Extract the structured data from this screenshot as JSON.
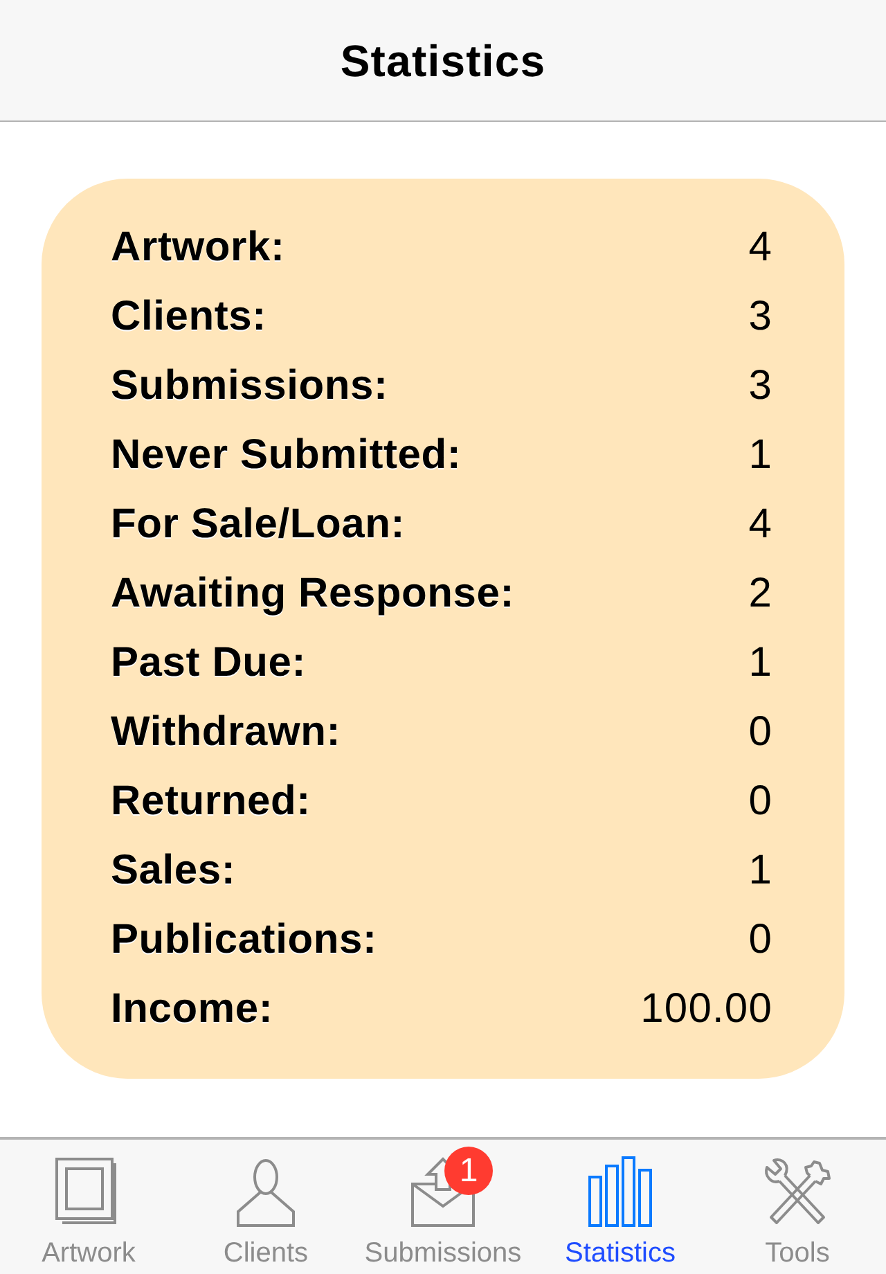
{
  "nav_bar": {
    "title": "Statistics"
  },
  "stats": [
    {
      "label": "Artwork:",
      "value": "4"
    },
    {
      "label": "Clients:",
      "value": "3"
    },
    {
      "label": "Submissions:",
      "value": "3"
    },
    {
      "label": "Never Submitted:",
      "value": "1"
    },
    {
      "label": "For Sale/Loan:",
      "value": "4"
    },
    {
      "label": "Awaiting Response:",
      "value": "2"
    },
    {
      "label": "Past Due:",
      "value": "1"
    },
    {
      "label": "Withdrawn:",
      "value": "0"
    },
    {
      "label": "Returned:",
      "value": "0"
    },
    {
      "label": "Sales:",
      "value": "1"
    },
    {
      "label": "Publications:",
      "value": "0"
    },
    {
      "label": "Income:",
      "value": "100.00"
    }
  ],
  "tab_bar": {
    "tabs": [
      {
        "kind": "artwork",
        "label": "Artwork",
        "selected": false
      },
      {
        "kind": "clients",
        "label": "Clients",
        "selected": false
      },
      {
        "kind": "submissions",
        "label": "Submissions",
        "selected": false,
        "badge": "1"
      },
      {
        "kind": "statistics",
        "label": "Statistics",
        "selected": true
      },
      {
        "kind": "tools",
        "label": "Tools",
        "selected": false
      }
    ]
  }
}
